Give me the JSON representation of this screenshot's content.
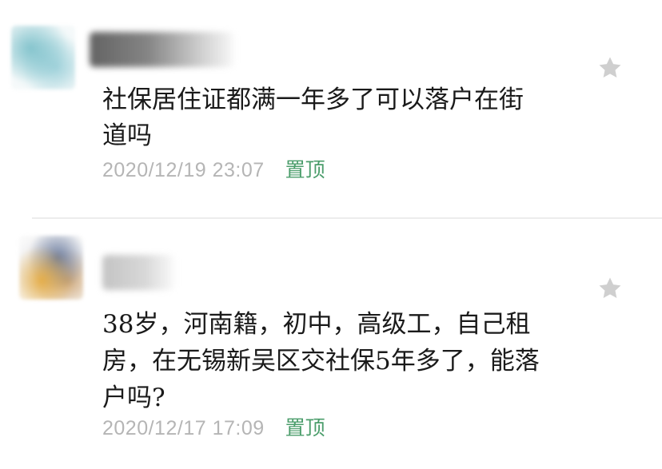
{
  "comments": [
    {
      "author_visible": "",
      "text": "社保居住证都满一年多了可以落户在街\n道吗",
      "time": "2020/12/19 23:07",
      "pin_label": "置顶",
      "icons": {
        "favorite": "star-icon"
      }
    },
    {
      "author_visible": "",
      "text": "38岁，河南籍，初中，高级工，自己租\n房，在无锡新吴区交社保5年多了，能落\n户吗?",
      "time": "2020/12/17 17:09",
      "pin_label": "置顶",
      "icons": {
        "favorite": "star-icon"
      }
    }
  ],
  "colors": {
    "pin": "#4b9d6b",
    "timestamp": "#b5b5b5",
    "star": "#cfcfcf",
    "text": "#1a1a1a"
  }
}
